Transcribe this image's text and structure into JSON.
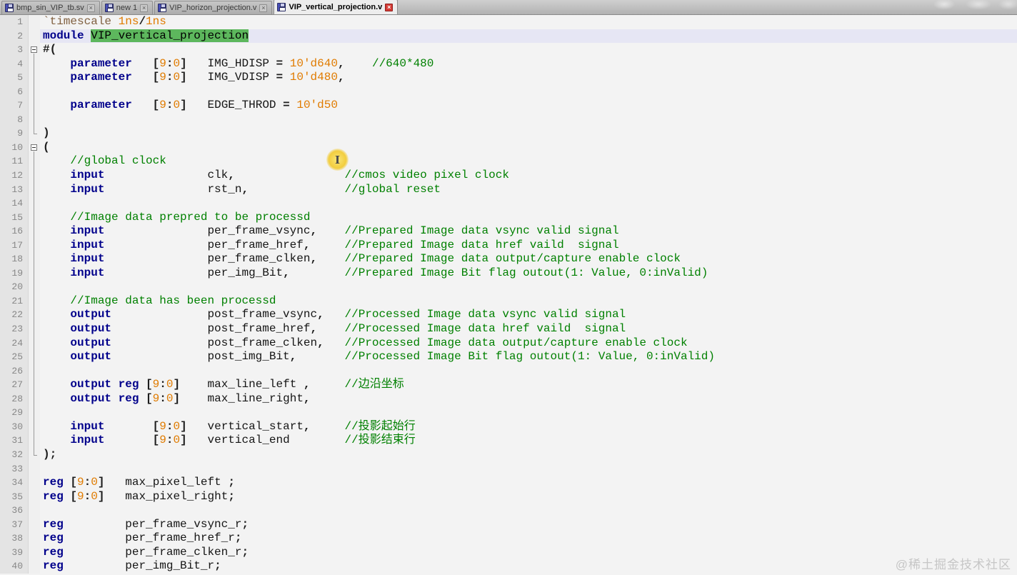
{
  "tabs": [
    {
      "label": "bmp_sin_VIP_tb.sv",
      "active": false,
      "close_label": "x"
    },
    {
      "label": "new 1",
      "active": false,
      "close_label": "x"
    },
    {
      "label": "VIP_horizon_projection.v",
      "active": false,
      "close_label": "x"
    },
    {
      "label": "VIP_vertical_projection.v",
      "active": true,
      "close_label": "x"
    }
  ],
  "colors": {
    "keyword": "#00008b",
    "number": "#e07b00",
    "comment": "#008000",
    "directive": "#806040",
    "selection_highlight": "#5db75d",
    "caret_line": "#e6e6f4",
    "active_tab_close": "#d43a34",
    "cursor_halo": "#f2cd3e"
  },
  "cursor": {
    "glyph": "I"
  },
  "watermark_bottom": "@稀土掘金技术社区",
  "editor": {
    "lines": [
      {
        "n": "1",
        "fold": "",
        "caret": false,
        "tokens": [
          [
            "dir",
            "`timescale"
          ],
          [
            "pl",
            " "
          ],
          [
            "num",
            "1ns"
          ],
          [
            "op",
            "/"
          ],
          [
            "num",
            "1ns"
          ]
        ]
      },
      {
        "n": "2",
        "fold": "",
        "caret": true,
        "tokens": [
          [
            "kw",
            "module"
          ],
          [
            "pl",
            " "
          ],
          [
            "hl",
            "VIP_vertical_projection"
          ]
        ]
      },
      {
        "n": "3",
        "fold": "start",
        "caret": false,
        "tokens": [
          [
            "op",
            "#("
          ]
        ]
      },
      {
        "n": "4",
        "fold": "cont",
        "caret": false,
        "tokens": [
          [
            "pl",
            "    "
          ],
          [
            "kw",
            "parameter"
          ],
          [
            "pl",
            "   "
          ],
          [
            "op",
            "["
          ],
          [
            "num",
            "9"
          ],
          [
            "op",
            ":"
          ],
          [
            "num",
            "0"
          ],
          [
            "op",
            "]"
          ],
          [
            "pl",
            "   "
          ],
          [
            "pl",
            "IMG_HDISP "
          ],
          [
            "op",
            "="
          ],
          [
            "pl",
            " "
          ],
          [
            "num",
            "10'd640"
          ],
          [
            "op",
            ","
          ],
          [
            "pl",
            "    "
          ],
          [
            "cmt",
            "//640*480"
          ]
        ]
      },
      {
        "n": "5",
        "fold": "cont",
        "caret": false,
        "tokens": [
          [
            "pl",
            "    "
          ],
          [
            "kw",
            "parameter"
          ],
          [
            "pl",
            "   "
          ],
          [
            "op",
            "["
          ],
          [
            "num",
            "9"
          ],
          [
            "op",
            ":"
          ],
          [
            "num",
            "0"
          ],
          [
            "op",
            "]"
          ],
          [
            "pl",
            "   "
          ],
          [
            "pl",
            "IMG_VDISP "
          ],
          [
            "op",
            "="
          ],
          [
            "pl",
            " "
          ],
          [
            "num",
            "10'd480"
          ],
          [
            "op",
            ","
          ]
        ]
      },
      {
        "n": "6",
        "fold": "cont",
        "caret": false,
        "tokens": []
      },
      {
        "n": "7",
        "fold": "cont",
        "caret": false,
        "tokens": [
          [
            "pl",
            "    "
          ],
          [
            "kw",
            "parameter"
          ],
          [
            "pl",
            "   "
          ],
          [
            "op",
            "["
          ],
          [
            "num",
            "9"
          ],
          [
            "op",
            ":"
          ],
          [
            "num",
            "0"
          ],
          [
            "op",
            "]"
          ],
          [
            "pl",
            "   "
          ],
          [
            "pl",
            "EDGE_THROD "
          ],
          [
            "op",
            "="
          ],
          [
            "pl",
            " "
          ],
          [
            "num",
            "10'd50"
          ]
        ]
      },
      {
        "n": "8",
        "fold": "cont",
        "caret": false,
        "tokens": []
      },
      {
        "n": "9",
        "fold": "end",
        "caret": false,
        "tokens": [
          [
            "op",
            ")"
          ]
        ]
      },
      {
        "n": "10",
        "fold": "start",
        "caret": false,
        "tokens": [
          [
            "op",
            "("
          ]
        ]
      },
      {
        "n": "11",
        "fold": "cont",
        "caret": false,
        "tokens": [
          [
            "pl",
            "    "
          ],
          [
            "cmt",
            "//global clock"
          ]
        ]
      },
      {
        "n": "12",
        "fold": "cont",
        "caret": false,
        "tokens": [
          [
            "pl",
            "    "
          ],
          [
            "kw",
            "input"
          ],
          [
            "pl",
            "               "
          ],
          [
            "pl",
            "clk"
          ],
          [
            "op",
            ","
          ],
          [
            "pl",
            "                "
          ],
          [
            "cmt",
            "//cmos video pixel clock"
          ]
        ]
      },
      {
        "n": "13",
        "fold": "cont",
        "caret": false,
        "tokens": [
          [
            "pl",
            "    "
          ],
          [
            "kw",
            "input"
          ],
          [
            "pl",
            "               "
          ],
          [
            "pl",
            "rst_n"
          ],
          [
            "op",
            ","
          ],
          [
            "pl",
            "              "
          ],
          [
            "cmt",
            "//global reset"
          ]
        ]
      },
      {
        "n": "14",
        "fold": "cont",
        "caret": false,
        "tokens": []
      },
      {
        "n": "15",
        "fold": "cont",
        "caret": false,
        "tokens": [
          [
            "pl",
            "    "
          ],
          [
            "cmt",
            "//Image data prepred to be processd"
          ]
        ]
      },
      {
        "n": "16",
        "fold": "cont",
        "caret": false,
        "tokens": [
          [
            "pl",
            "    "
          ],
          [
            "kw",
            "input"
          ],
          [
            "pl",
            "               "
          ],
          [
            "pl",
            "per_frame_vsync"
          ],
          [
            "op",
            ","
          ],
          [
            "pl",
            "    "
          ],
          [
            "cmt",
            "//Prepared Image data vsync valid signal"
          ]
        ]
      },
      {
        "n": "17",
        "fold": "cont",
        "caret": false,
        "tokens": [
          [
            "pl",
            "    "
          ],
          [
            "kw",
            "input"
          ],
          [
            "pl",
            "               "
          ],
          [
            "pl",
            "per_frame_href"
          ],
          [
            "op",
            ","
          ],
          [
            "pl",
            "     "
          ],
          [
            "cmt",
            "//Prepared Image data href vaild  signal"
          ]
        ]
      },
      {
        "n": "18",
        "fold": "cont",
        "caret": false,
        "tokens": [
          [
            "pl",
            "    "
          ],
          [
            "kw",
            "input"
          ],
          [
            "pl",
            "               "
          ],
          [
            "pl",
            "per_frame_clken"
          ],
          [
            "op",
            ","
          ],
          [
            "pl",
            "    "
          ],
          [
            "cmt",
            "//Prepared Image data output/capture enable clock"
          ]
        ]
      },
      {
        "n": "19",
        "fold": "cont",
        "caret": false,
        "tokens": [
          [
            "pl",
            "    "
          ],
          [
            "kw",
            "input"
          ],
          [
            "pl",
            "               "
          ],
          [
            "pl",
            "per_img_Bit"
          ],
          [
            "op",
            ","
          ],
          [
            "pl",
            "        "
          ],
          [
            "cmt",
            "//Prepared Image Bit flag outout(1: Value, 0:inValid)"
          ]
        ]
      },
      {
        "n": "20",
        "fold": "cont",
        "caret": false,
        "tokens": []
      },
      {
        "n": "21",
        "fold": "cont",
        "caret": false,
        "tokens": [
          [
            "pl",
            "    "
          ],
          [
            "cmt",
            "//Image data has been processd"
          ]
        ]
      },
      {
        "n": "22",
        "fold": "cont",
        "caret": false,
        "tokens": [
          [
            "pl",
            "    "
          ],
          [
            "kw",
            "output"
          ],
          [
            "pl",
            "              "
          ],
          [
            "pl",
            "post_frame_vsync"
          ],
          [
            "op",
            ","
          ],
          [
            "pl",
            "   "
          ],
          [
            "cmt",
            "//Processed Image data vsync valid signal"
          ]
        ]
      },
      {
        "n": "23",
        "fold": "cont",
        "caret": false,
        "tokens": [
          [
            "pl",
            "    "
          ],
          [
            "kw",
            "output"
          ],
          [
            "pl",
            "              "
          ],
          [
            "pl",
            "post_frame_href"
          ],
          [
            "op",
            ","
          ],
          [
            "pl",
            "    "
          ],
          [
            "cmt",
            "//Processed Image data href vaild  signal"
          ]
        ]
      },
      {
        "n": "24",
        "fold": "cont",
        "caret": false,
        "tokens": [
          [
            "pl",
            "    "
          ],
          [
            "kw",
            "output"
          ],
          [
            "pl",
            "              "
          ],
          [
            "pl",
            "post_frame_clken"
          ],
          [
            "op",
            ","
          ],
          [
            "pl",
            "   "
          ],
          [
            "cmt",
            "//Processed Image data output/capture enable clock"
          ]
        ]
      },
      {
        "n": "25",
        "fold": "cont",
        "caret": false,
        "tokens": [
          [
            "pl",
            "    "
          ],
          [
            "kw",
            "output"
          ],
          [
            "pl",
            "              "
          ],
          [
            "pl",
            "post_img_Bit"
          ],
          [
            "op",
            ","
          ],
          [
            "pl",
            "       "
          ],
          [
            "cmt",
            "//Processed Image Bit flag outout(1: Value, 0:inValid)"
          ]
        ]
      },
      {
        "n": "26",
        "fold": "cont",
        "caret": false,
        "tokens": []
      },
      {
        "n": "27",
        "fold": "cont",
        "caret": false,
        "tokens": [
          [
            "pl",
            "    "
          ],
          [
            "kw",
            "output"
          ],
          [
            "pl",
            " "
          ],
          [
            "kw",
            "reg"
          ],
          [
            "pl",
            " "
          ],
          [
            "op",
            "["
          ],
          [
            "num",
            "9"
          ],
          [
            "op",
            ":"
          ],
          [
            "num",
            "0"
          ],
          [
            "op",
            "]"
          ],
          [
            "pl",
            "    "
          ],
          [
            "pl",
            "max_line_left "
          ],
          [
            "op",
            ","
          ],
          [
            "pl",
            "     "
          ],
          [
            "cmt",
            "//边沿坐标"
          ]
        ]
      },
      {
        "n": "28",
        "fold": "cont",
        "caret": false,
        "tokens": [
          [
            "pl",
            "    "
          ],
          [
            "kw",
            "output"
          ],
          [
            "pl",
            " "
          ],
          [
            "kw",
            "reg"
          ],
          [
            "pl",
            " "
          ],
          [
            "op",
            "["
          ],
          [
            "num",
            "9"
          ],
          [
            "op",
            ":"
          ],
          [
            "num",
            "0"
          ],
          [
            "op",
            "]"
          ],
          [
            "pl",
            "    "
          ],
          [
            "pl",
            "max_line_right"
          ],
          [
            "op",
            ","
          ]
        ]
      },
      {
        "n": "29",
        "fold": "cont",
        "caret": false,
        "tokens": []
      },
      {
        "n": "30",
        "fold": "cont",
        "caret": false,
        "tokens": [
          [
            "pl",
            "    "
          ],
          [
            "kw",
            "input"
          ],
          [
            "pl",
            "       "
          ],
          [
            "op",
            "["
          ],
          [
            "num",
            "9"
          ],
          [
            "op",
            ":"
          ],
          [
            "num",
            "0"
          ],
          [
            "op",
            "]"
          ],
          [
            "pl",
            "   "
          ],
          [
            "pl",
            "vertical_start"
          ],
          [
            "op",
            ","
          ],
          [
            "pl",
            "     "
          ],
          [
            "cmt",
            "//投影起始行"
          ]
        ]
      },
      {
        "n": "31",
        "fold": "cont",
        "caret": false,
        "tokens": [
          [
            "pl",
            "    "
          ],
          [
            "kw",
            "input"
          ],
          [
            "pl",
            "       "
          ],
          [
            "op",
            "["
          ],
          [
            "num",
            "9"
          ],
          [
            "op",
            ":"
          ],
          [
            "num",
            "0"
          ],
          [
            "op",
            "]"
          ],
          [
            "pl",
            "   "
          ],
          [
            "pl",
            "vertical_end"
          ],
          [
            "pl",
            "        "
          ],
          [
            "cmt",
            "//投影结束行"
          ]
        ]
      },
      {
        "n": "32",
        "fold": "end",
        "caret": false,
        "tokens": [
          [
            "op",
            ");"
          ]
        ]
      },
      {
        "n": "33",
        "fold": "",
        "caret": false,
        "tokens": []
      },
      {
        "n": "34",
        "fold": "",
        "caret": false,
        "tokens": [
          [
            "kw",
            "reg"
          ],
          [
            "pl",
            " "
          ],
          [
            "op",
            "["
          ],
          [
            "num",
            "9"
          ],
          [
            "op",
            ":"
          ],
          [
            "num",
            "0"
          ],
          [
            "op",
            "]"
          ],
          [
            "pl",
            "   "
          ],
          [
            "pl",
            "max_pixel_left "
          ],
          [
            "op",
            ";"
          ]
        ]
      },
      {
        "n": "35",
        "fold": "",
        "caret": false,
        "tokens": [
          [
            "kw",
            "reg"
          ],
          [
            "pl",
            " "
          ],
          [
            "op",
            "["
          ],
          [
            "num",
            "9"
          ],
          [
            "op",
            ":"
          ],
          [
            "num",
            "0"
          ],
          [
            "op",
            "]"
          ],
          [
            "pl",
            "   "
          ],
          [
            "pl",
            "max_pixel_right"
          ],
          [
            "op",
            ";"
          ]
        ]
      },
      {
        "n": "36",
        "fold": "",
        "caret": false,
        "tokens": []
      },
      {
        "n": "37",
        "fold": "",
        "caret": false,
        "tokens": [
          [
            "kw",
            "reg"
          ],
          [
            "pl",
            "         "
          ],
          [
            "pl",
            "per_frame_vsync_r"
          ],
          [
            "op",
            ";"
          ]
        ]
      },
      {
        "n": "38",
        "fold": "",
        "caret": false,
        "tokens": [
          [
            "kw",
            "reg"
          ],
          [
            "pl",
            "         "
          ],
          [
            "pl",
            "per_frame_href_r"
          ],
          [
            "op",
            ";"
          ]
        ]
      },
      {
        "n": "39",
        "fold": "",
        "caret": false,
        "tokens": [
          [
            "kw",
            "reg"
          ],
          [
            "pl",
            "         "
          ],
          [
            "pl",
            "per_frame_clken_r"
          ],
          [
            "op",
            ";"
          ]
        ]
      },
      {
        "n": "40",
        "fold": "",
        "caret": false,
        "tokens": [
          [
            "kw",
            "reg"
          ],
          [
            "pl",
            "         "
          ],
          [
            "pl",
            "per_img_Bit_r"
          ],
          [
            "op",
            ";"
          ]
        ]
      }
    ]
  }
}
